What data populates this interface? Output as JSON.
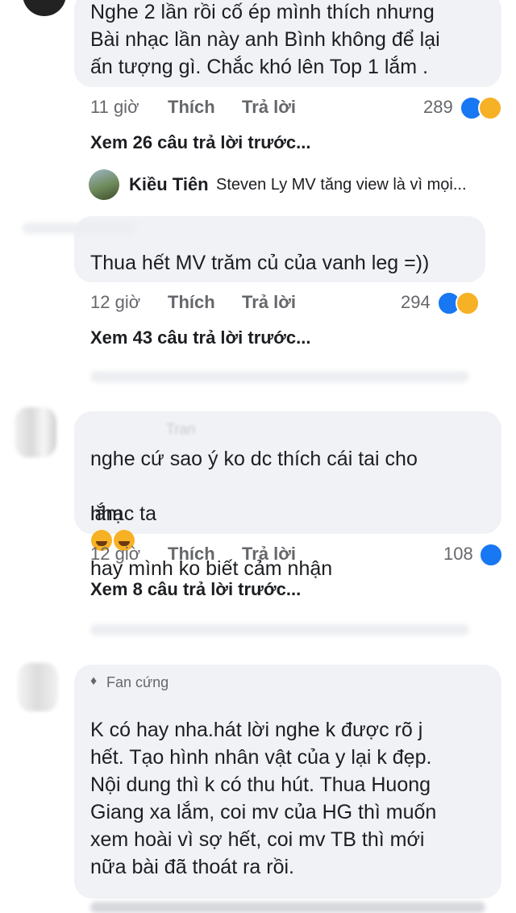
{
  "comments": [
    {
      "text": "Nghe 2 lần rồi cố ép mình thích nhưng\nBài nhạc lần này anh Bình không để lại\nấn tượng gì. Chắc khó lên Top 1 lắm .",
      "time": "11 giờ",
      "like": "Thích",
      "reply": "Trả lời",
      "count": "289",
      "view_more": "Xem 26 câu trả lời trước...",
      "reply_preview": {
        "name": "Kiều Tiên",
        "text": "Steven Ly MV tăng view là vì mọi..."
      }
    },
    {
      "text": "Thua hết MV trăm củ của vanh leg =))",
      "time": "12 giờ",
      "like": "Thích",
      "reply": "Trả lời",
      "count": "294",
      "view_more": "Xem 43 câu trả lời trước..."
    },
    {
      "author": "Tran",
      "text_1": "nghe cứ sao ý ko dc thích cái tai cho",
      "text_2a": "lắm",
      "text_2b": "hay mình ko biết cảm nhận",
      "text_3": "nhạc ta",
      "time": "12 giờ",
      "like": "Thích",
      "reply": "Trả lời",
      "count": "108",
      "view_more": "Xem 8 câu trả lời trước..."
    },
    {
      "badge": "Fan cứng",
      "text": "K có hay nha.hát lời nghe k được rõ j\nhết. Tạo hình nhân vật của y lại k đẹp.\nNội dung thì k có thu hút. Thua Huong\nGiang xa lắm, coi mv của HG thì muốn\nxem hoài vì sợ hết, coi mv TB thì mới\nnữa bài đã thoát ra rồi."
    }
  ],
  "colors": {
    "like": "#1877f2",
    "haha": "#f7b125",
    "bubble": "#f0f2f5",
    "meta": "#65676b"
  },
  "icons": [
    "like-reaction-icon",
    "haha-reaction-icon",
    "fan-badge-icon"
  ]
}
